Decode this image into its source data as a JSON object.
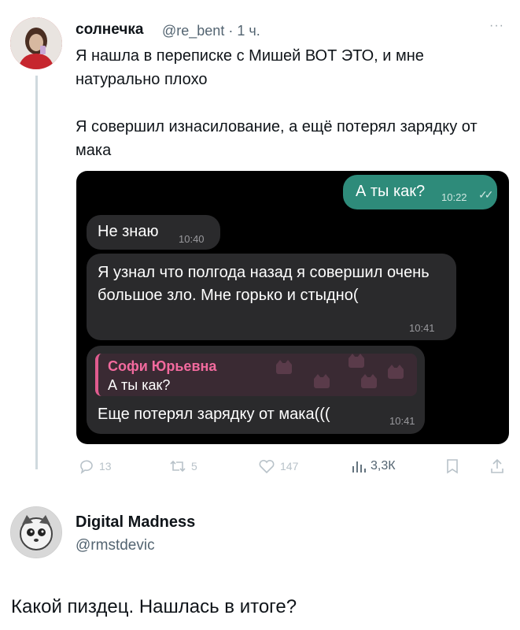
{
  "tweet": {
    "author_name": "солнечка",
    "handle": "@re_bent",
    "separator": "·",
    "time": "1 ч.",
    "more": "···",
    "text": "Я нашла в переписке с Мишей ВОТ ЭТО, и мне натурально плохо\n\nЯ совершил изнасилование, а ещё потерял зарядку от мака"
  },
  "chat": {
    "outgoing": {
      "text": "А ты как?",
      "time": "10:22"
    },
    "messages": [
      {
        "text": "Не знаю",
        "time": "10:40"
      },
      {
        "text": "Я узнал что полгода назад я совершил очень большое зло. Мне горько и стыдно(",
        "time": "10:41"
      },
      {
        "reply_author": "Софи Юрьевна",
        "reply_quote": "А ты как?",
        "text": "Еще потерял зарядку от мака(((",
        "time": "10:41"
      }
    ]
  },
  "actions": {
    "replies": "13",
    "retweets": "5",
    "likes": "147",
    "views": "3,3К"
  },
  "reply": {
    "author_name": "Digital Madness",
    "handle": "@rmstdevic",
    "text": "Какой пиздец. Нашлась в итоге?"
  },
  "colors": {
    "outgoing_bubble": "#2e8b7a",
    "incoming_bubble": "#2a2a2c",
    "reply_accent": "#f26a9e",
    "chat_background": "#000000"
  }
}
